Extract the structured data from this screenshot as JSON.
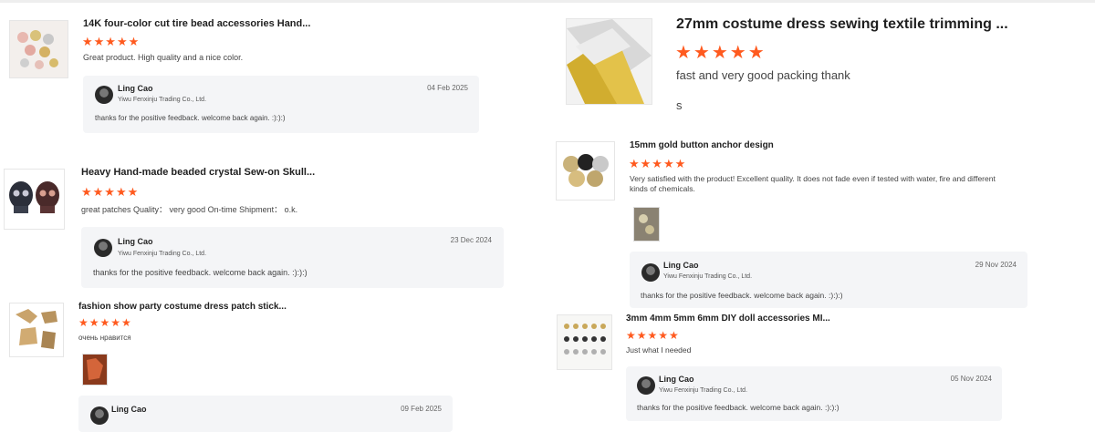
{
  "reviews": [
    {
      "title": "14K four-color cut tire bead accessories Hand...",
      "stars": "★★★★★",
      "text": "Great product. High quality and a nice color.",
      "reply": {
        "seller": "Ling Cao",
        "company": "Yiwu Fenxinju Trading Co., Ltd.",
        "date": "04 Feb 2025",
        "text": "thanks for the positive feedback. welcome back again. :):):)"
      }
    },
    {
      "title": "Heavy Hand-made beaded crystal Sew-on Skull...",
      "stars": "★★★★★",
      "text": "great patches Quality： very good On-time Shipment： o.k.",
      "reply": {
        "seller": "Ling Cao",
        "company": "Yiwu Fenxinju Trading Co., Ltd.",
        "date": "23 Dec 2024",
        "text": "thanks for the positive feedback. welcome back again. :):):)"
      }
    },
    {
      "title": "fashion show party costume dress patch stick...",
      "stars": "★★★★★",
      "text": "очень нравится",
      "reply": {
        "seller": "Ling Cao",
        "company": "",
        "date": "09 Feb 2025",
        "text": ""
      }
    },
    {
      "title": "27mm costume dress sewing textile trimming ...",
      "stars": "★★★★★",
      "text": "fast and very good packing thank",
      "extra": "s"
    },
    {
      "title": "15mm gold button anchor design",
      "stars": "★★★★★",
      "text": "Very satisfied with the product! Excellent quality. It does not fade even if tested with water, fire and different kinds of chemicals.",
      "reply": {
        "seller": "Ling Cao",
        "company": "Yiwu Fenxinju Trading Co., Ltd.",
        "date": "29 Nov 2024",
        "text": "thanks for the positive feedback. welcome back again. :):):)"
      }
    },
    {
      "title": "3mm 4mm 5mm 6mm DIY doll accessories MI...",
      "stars": "★★★★★",
      "text": "Just what I needed",
      "reply": {
        "seller": "Ling Cao",
        "company": "Yiwu Fenxinju Trading Co., Ltd.",
        "date": "05 Nov 2024",
        "text": "thanks for the positive feedback. welcome back again. :):):)"
      }
    }
  ],
  "colors": {
    "star": "#ff5a1f",
    "reply_bg": "#f4f5f7"
  }
}
